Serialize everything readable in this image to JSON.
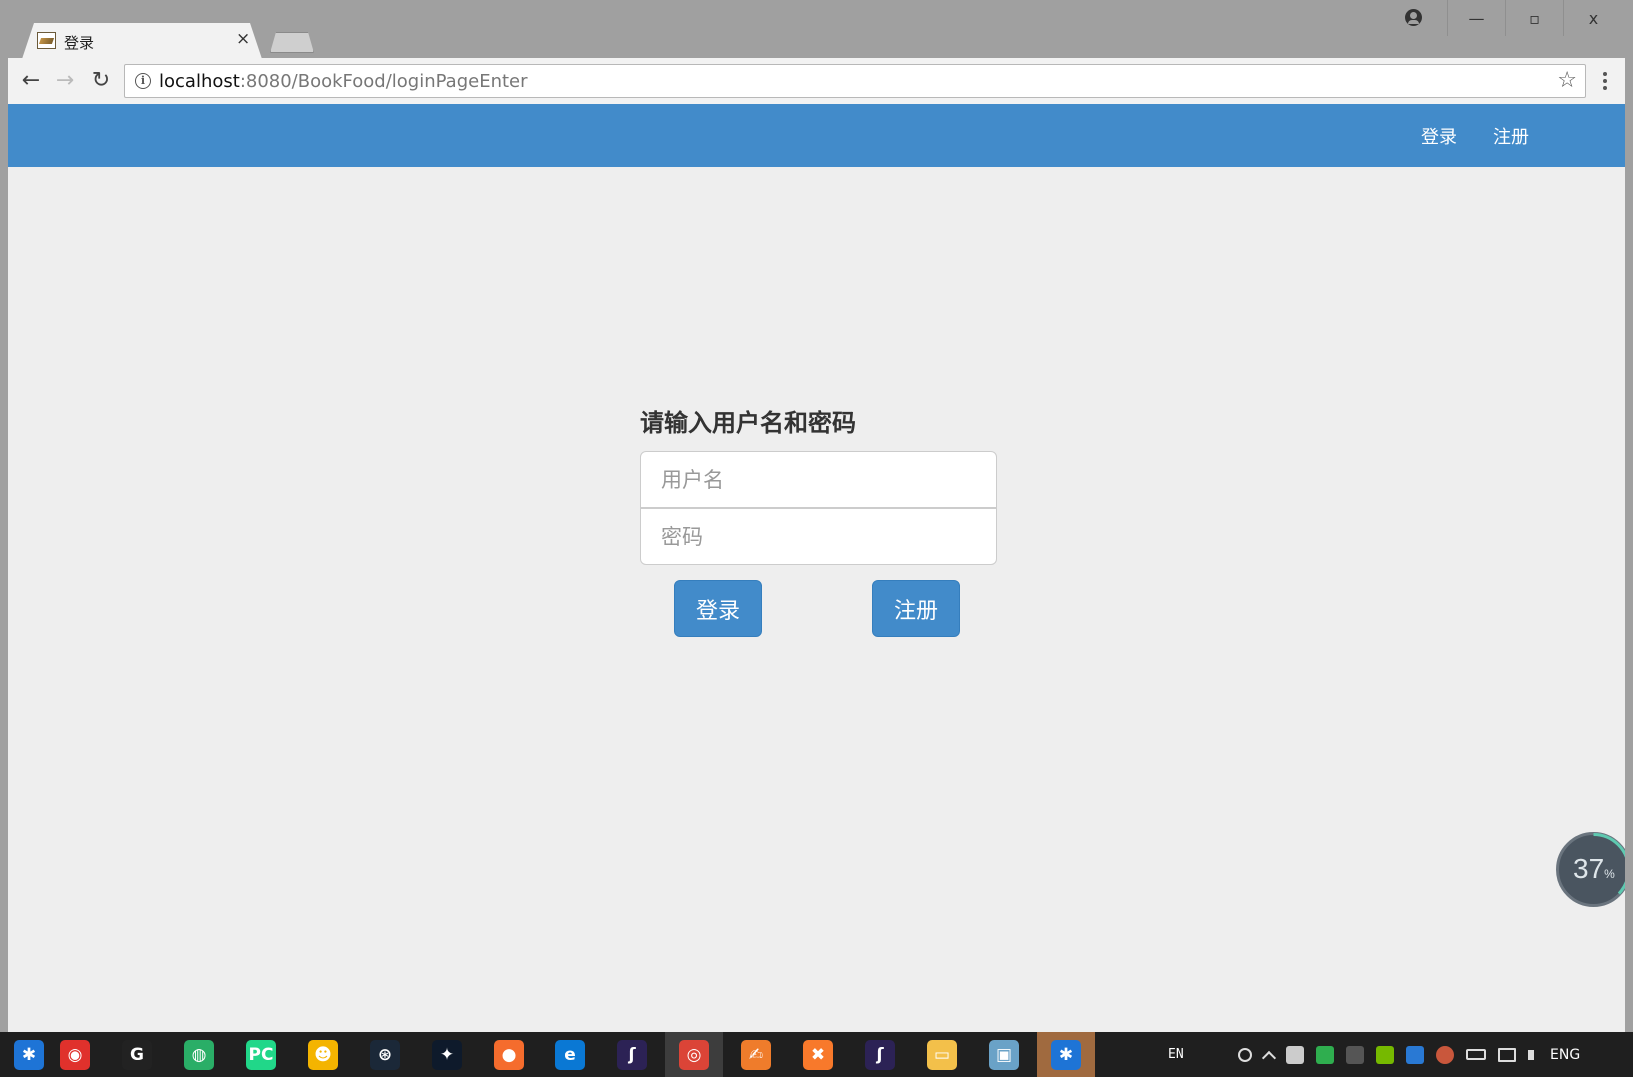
{
  "browser": {
    "tab_title": "登录",
    "tab_close": "×",
    "url_host": "localhost",
    "url_rest": ":8080/BookFood/loginPageEnter",
    "back": "←",
    "forward": "→",
    "reload": "↻",
    "star": "☆",
    "window_controls": {
      "minimize": "—",
      "maximize": "▫",
      "close": "x"
    }
  },
  "navbar": {
    "login": "登录",
    "register": "注册",
    "color": "#428bca"
  },
  "login_form": {
    "heading": "请输入用户名和密码",
    "username_placeholder": "用户名",
    "password_placeholder": "密码",
    "login_button": "登录",
    "register_button": "注册"
  },
  "progress_widget": {
    "value": "37",
    "unit": "%",
    "fraction": 0.37
  },
  "taskbar": {
    "apps": [
      {
        "name": "feishu-icon",
        "color": "#1e74d6",
        "glyph": "✱"
      },
      {
        "name": "netease-music-icon",
        "color": "#e0312c",
        "glyph": "◉"
      },
      {
        "name": "g-app-icon",
        "color": "#222222",
        "glyph": "G"
      },
      {
        "name": "wechat-icon",
        "color": "#2aae67",
        "glyph": "◍"
      },
      {
        "name": "pycharm-icon",
        "color": "#21d789",
        "glyph": "PC"
      },
      {
        "name": "qq-icon",
        "color": "#f4b400",
        "glyph": "☻"
      },
      {
        "name": "steam-icon",
        "color": "#1b2838",
        "glyph": "⊛"
      },
      {
        "name": "battlenet-icon",
        "color": "#0e1a2b",
        "glyph": "✦"
      },
      {
        "name": "origin-icon",
        "color": "#f56c2d",
        "glyph": "●"
      },
      {
        "name": "edge-icon",
        "color": "#0a78d4",
        "glyph": "e"
      },
      {
        "name": "eclipse-icon",
        "color": "#2c2255",
        "glyph": "ʃ"
      },
      {
        "name": "chrome-icon",
        "color": "#db4437",
        "glyph": "◎"
      },
      {
        "name": "sublime-icon",
        "color": "#ef7c2b",
        "glyph": "✍"
      },
      {
        "name": "xampp-icon",
        "color": "#f8792b",
        "glyph": "✖"
      },
      {
        "name": "eclipse2-icon",
        "color": "#2c2255",
        "glyph": "ʃ"
      },
      {
        "name": "file-explorer-icon",
        "color": "#f3c04a",
        "glyph": "▭"
      },
      {
        "name": "window-app-icon",
        "color": "#6aa2c7",
        "glyph": "▣"
      },
      {
        "name": "feishu2-icon",
        "color": "#1e74d6",
        "glyph": "✱"
      }
    ],
    "tray_lang": "EN",
    "tray_input": "ENG"
  }
}
